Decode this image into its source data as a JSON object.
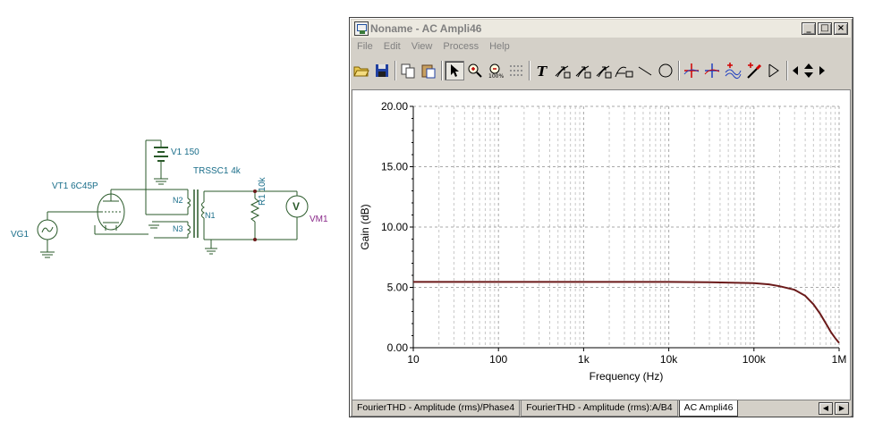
{
  "schematic": {
    "labels": {
      "v1": "V1 150",
      "trans": "TRSSC1 4k",
      "vt1": "VT1 6C45P",
      "n2": "N2",
      "n1": "N1",
      "n3": "N3",
      "r1": "R1 10k",
      "vm1": "VM1",
      "vg1": "VG1",
      "vm_symbol": "V"
    }
  },
  "window": {
    "title": "Noname - AC Ampli46",
    "controls": {
      "minimize": "_",
      "maximize": "□",
      "close": "×"
    },
    "menu": [
      "File",
      "Edit",
      "View",
      "Process",
      "Help"
    ],
    "toolbar": [
      "open-folder-icon",
      "save-icon",
      "copy-icon",
      "paste-icon",
      "pointer-icon",
      "zoom-in-icon",
      "zoom-100-icon",
      "grid-icon",
      "text-icon",
      "annotate-a-icon",
      "annotate-b-icon",
      "annotate-c-icon",
      "line-icon",
      "circle-icon",
      "cursor-a-icon",
      "cursor-b-icon",
      "add-curve-icon",
      "probe-icon",
      "marker-icon",
      "arrow-left-icon",
      "arrow-updown-icon",
      "arrow-right-icon"
    ],
    "tabs": [
      "FourierTHD - Amplitude (rms)/Phase4",
      "FourierTHD - Amplitude (rms):A/B4",
      "AC Ampli46"
    ],
    "active_tab": 2
  },
  "chart_data": {
    "type": "line",
    "xlabel": "Frequency (Hz)",
    "ylabel": "Gain (dB)",
    "xscale": "log",
    "xlim": [
      10,
      1000000
    ],
    "ylim": [
      0,
      20
    ],
    "xticks": [
      "10",
      "100",
      "1k",
      "10k",
      "100k",
      "1M"
    ],
    "xtick_values": [
      10,
      100,
      1000,
      10000,
      100000,
      1000000
    ],
    "yticks": [
      "0.00",
      "5.00",
      "10.00",
      "15.00",
      "20.00"
    ],
    "ytick_values": [
      0,
      5,
      10,
      15,
      20
    ],
    "grid": true,
    "line_color": "#6b1a1a",
    "series": [
      {
        "x": [
          10,
          100,
          1000,
          10000,
          30000,
          100000,
          150000,
          200000,
          300000,
          400000,
          500000,
          600000,
          700000,
          800000,
          900000,
          1000000
        ],
        "y": [
          5.45,
          5.45,
          5.45,
          5.45,
          5.42,
          5.35,
          5.25,
          5.1,
          4.8,
          4.3,
          3.6,
          2.8,
          2.0,
          1.3,
          0.8,
          0.4
        ]
      }
    ]
  }
}
